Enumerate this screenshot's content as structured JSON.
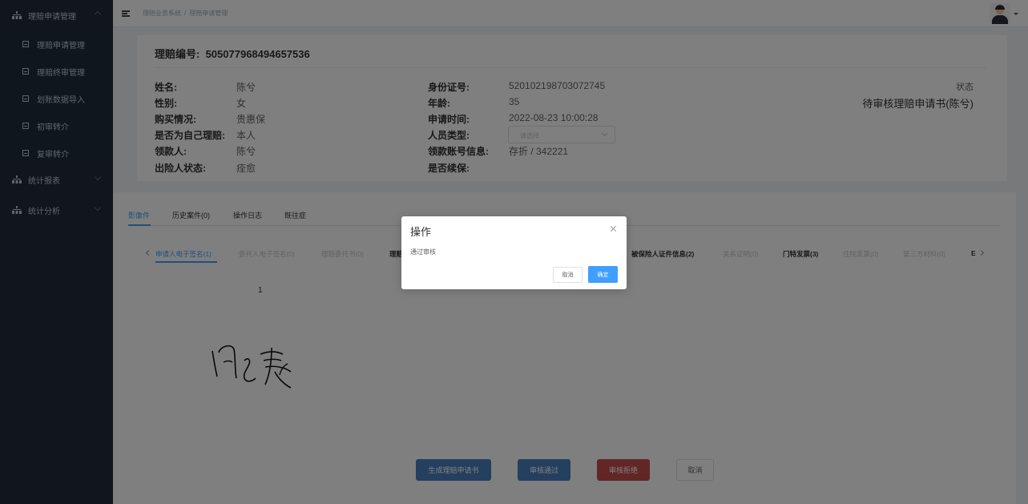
{
  "sidebar": {
    "groups": [
      {
        "label": "理赔申请管理",
        "icon": "sitemap-icon"
      },
      {
        "label": "统计报表",
        "icon": "sitemap-icon"
      },
      {
        "label": "统计分析",
        "icon": "sitemap-icon"
      }
    ],
    "items": [
      {
        "label": "理赔申请管理",
        "icon": "table-icon"
      },
      {
        "label": "理赔终审管理",
        "icon": "table-icon"
      },
      {
        "label": "划账数据导入",
        "icon": "table-icon"
      },
      {
        "label": "初审转介",
        "icon": "table-icon"
      },
      {
        "label": "复审转介",
        "icon": "table-icon"
      }
    ]
  },
  "topbar": {
    "breadcrumb": [
      "理赔业务系统",
      "理赔申请管理"
    ],
    "separator": "/"
  },
  "claim": {
    "number_label": "理赔编号:",
    "number": "505077968494657536",
    "fields": {
      "name": {
        "label": "姓名:",
        "value": "陈兮"
      },
      "gender": {
        "label": "性别:",
        "value": "女"
      },
      "purchase": {
        "label": "购买情况:",
        "value": "贵惠保"
      },
      "self_claim": {
        "label": "是否为自己理赔:",
        "value": "本人"
      },
      "payee": {
        "label": "领款人:",
        "value": "陈兮"
      },
      "insured_status": {
        "label": "出险人状态:",
        "value": "痊愈"
      },
      "id_no": {
        "label": "身份证号:",
        "value": "520102198703072745"
      },
      "age": {
        "label": "年龄:",
        "value": "35"
      },
      "apply_time": {
        "label": "申请时间:",
        "value": "2022-08-23 10:00:28"
      },
      "person_type": {
        "label": "人员类型:",
        "placeholder": "请选择"
      },
      "account": {
        "label": "领款账号信息:",
        "value": "存折 / 342221"
      },
      "renewal": {
        "label": "是否续保:",
        "value": ""
      }
    },
    "status_label": "状态",
    "status_value": "待审核理赔申请书(陈兮)"
  },
  "tabs": [
    "影像件",
    "历史案件(0)",
    "操作日志",
    "既往症"
  ],
  "subtabs": [
    {
      "label": "申请人电子签名(1)",
      "state": "active"
    },
    {
      "label": "委托人电子签名(0)",
      "state": "muted"
    },
    {
      "label": "理赔委托书(0)",
      "state": "muted"
    },
    {
      "label": "理赔",
      "state": "dark"
    },
    {
      "label": "被保险人证件信息(2)",
      "state": "dark"
    },
    {
      "label": "关系证明(0)",
      "state": "muted"
    },
    {
      "label": "门特发票(3)",
      "state": "dark"
    },
    {
      "label": "住院发票(0)",
      "state": "muted"
    },
    {
      "label": "第三方材料(0)",
      "state": "muted"
    },
    {
      "label": "E",
      "state": "dark"
    }
  ],
  "viewer": {
    "page": "1"
  },
  "actions": {
    "generate": "生成理赔申请书",
    "approve": "审核通过",
    "reject": "审核拒绝",
    "cancel": "取消"
  },
  "dialog": {
    "title": "操作",
    "message": "通过审核",
    "cancel": "取消",
    "confirm": "确定"
  },
  "colors": {
    "sidebar_bg": "#222c3c",
    "primary": "#409eff",
    "danger": "#c44d4f"
  }
}
